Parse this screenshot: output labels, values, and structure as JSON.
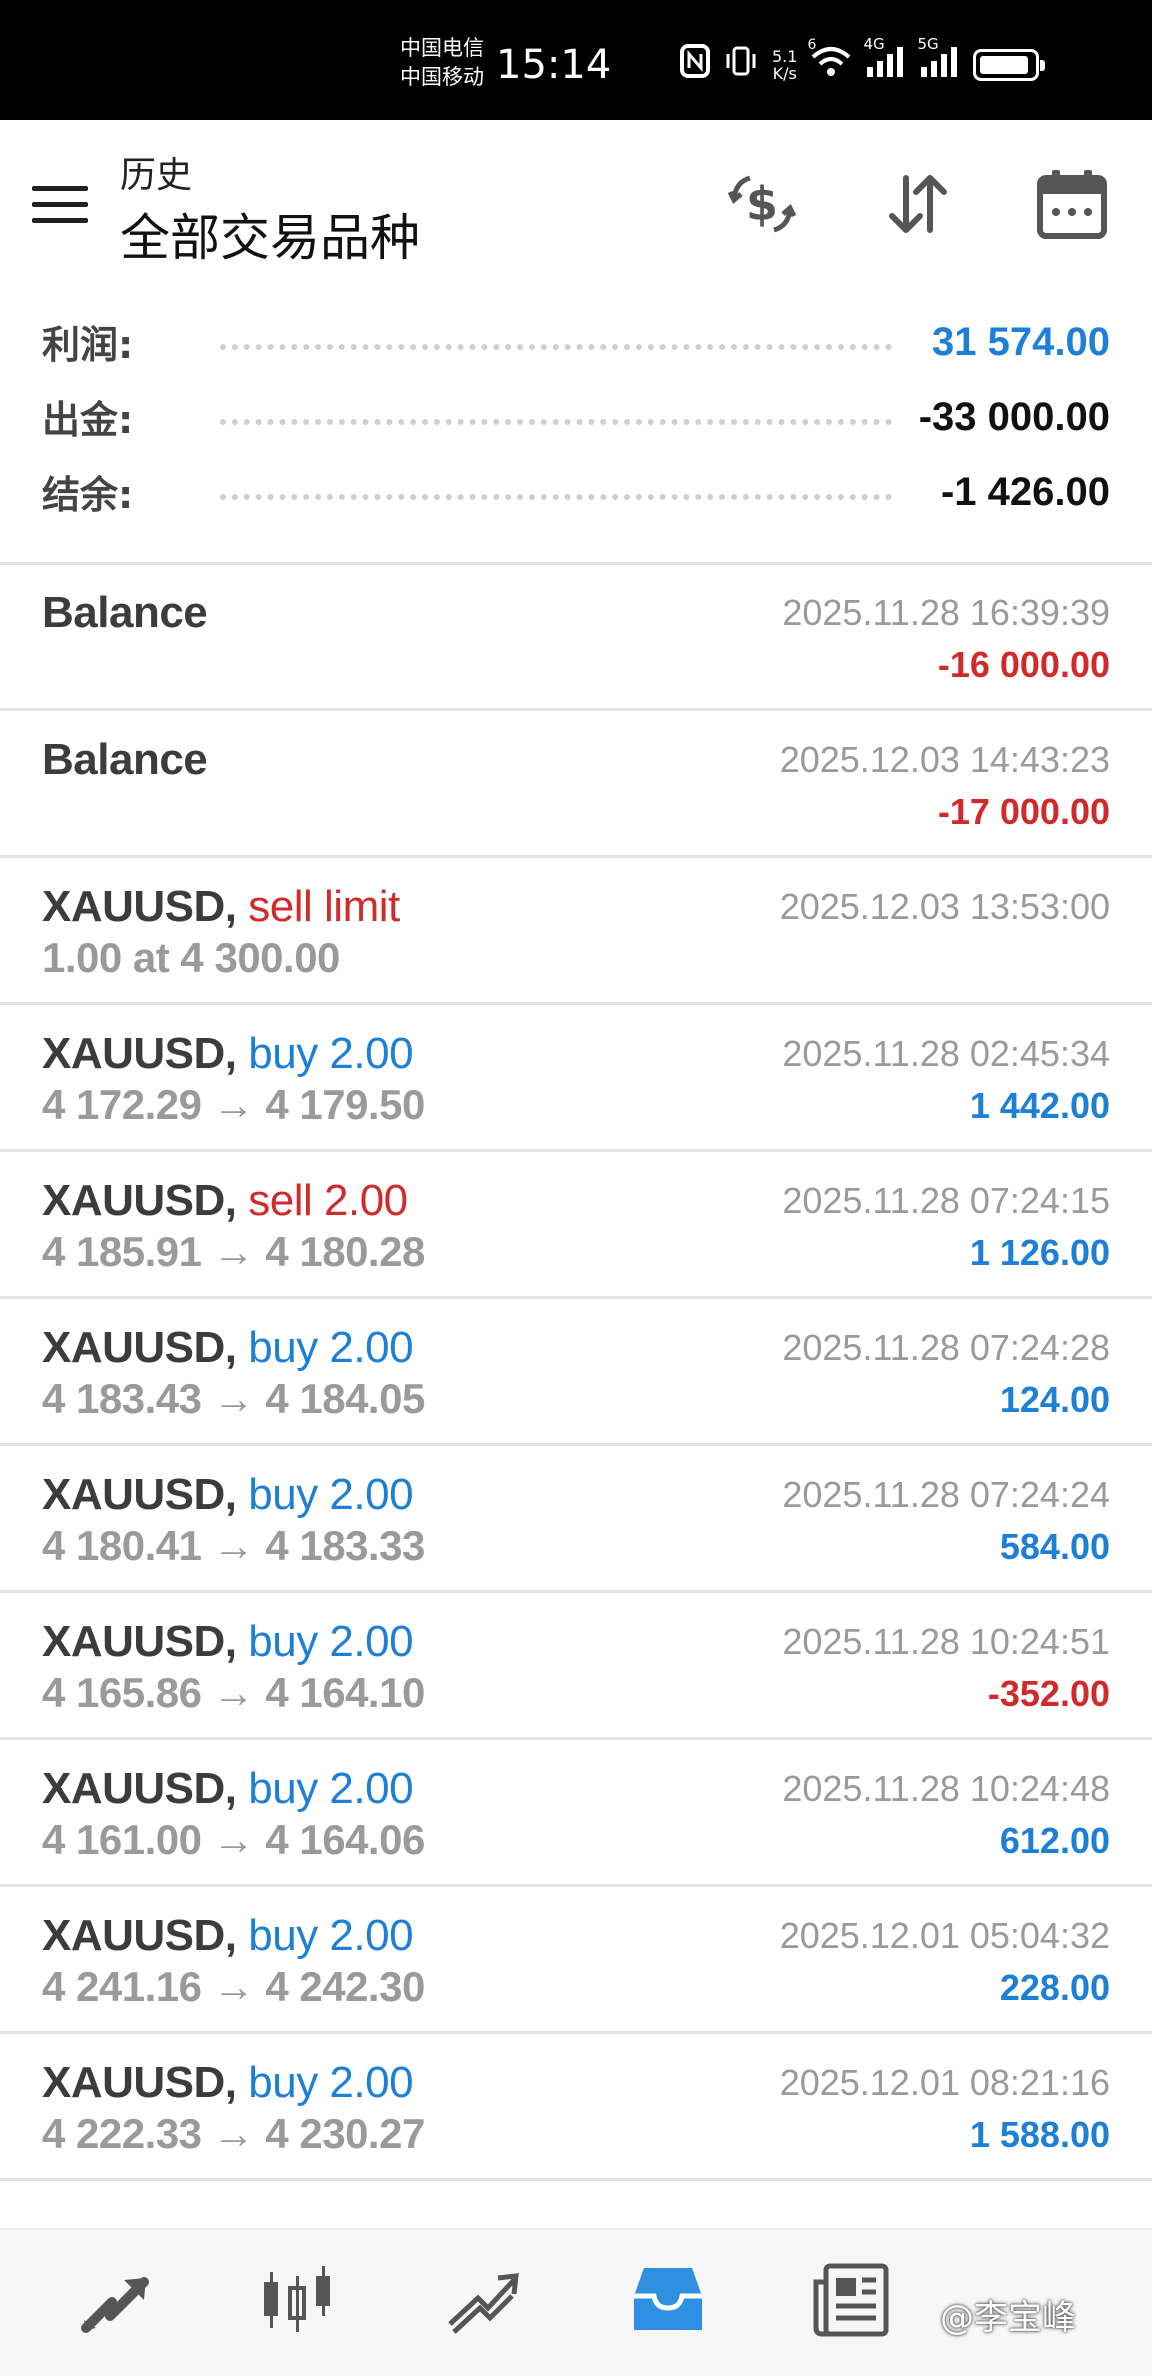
{
  "status_bar": {
    "carrier_1": "中国电信",
    "carrier_2": "中国移动",
    "time": "15:14",
    "net_speed_value": "5.1",
    "net_speed_unit": "K/s",
    "wifi_label": "6",
    "signal_1_label": "4G",
    "signal_2_label": "5G"
  },
  "header": {
    "title_small": "历史",
    "title_big": "全部交易品种",
    "icons": [
      "menu-icon",
      "currency-exchange-icon",
      "sort-icon",
      "calendar-icon"
    ]
  },
  "summary": {
    "profit_label": "利润:",
    "profit_value": "31 574.00",
    "withdrawal_label": "出金:",
    "withdrawal_value": "-33 000.00",
    "balance_label": "结余:",
    "balance_value": "-1 426.00"
  },
  "rows": [
    {
      "symbol": "Balance",
      "type": "",
      "type_class": "",
      "prices": "",
      "time": "2025.11.28 16:39:39",
      "profit": "-16 000.00",
      "profit_class": "neg"
    },
    {
      "symbol": "Balance",
      "type": "",
      "type_class": "",
      "prices": "",
      "time": "2025.12.03 14:43:23",
      "profit": "-17 000.00",
      "profit_class": "neg"
    },
    {
      "symbol": "XAUUSD,",
      "type": "sell limit",
      "type_class": "sell",
      "prices": "1.00 at 4 300.00",
      "time": "2025.12.03 13:53:00",
      "profit": "",
      "profit_class": "pos"
    },
    {
      "symbol": "XAUUSD,",
      "type": "buy 2.00",
      "type_class": "buy",
      "prices": "4 172.29 → 4 179.50",
      "time": "2025.11.28 02:45:34",
      "profit": "1 442.00",
      "profit_class": "pos"
    },
    {
      "symbol": "XAUUSD,",
      "type": "sell 2.00",
      "type_class": "sell",
      "prices": "4 185.91 → 4 180.28",
      "time": "2025.11.28 07:24:15",
      "profit": "1 126.00",
      "profit_class": "pos"
    },
    {
      "symbol": "XAUUSD,",
      "type": "buy 2.00",
      "type_class": "buy",
      "prices": "4 183.43 → 4 184.05",
      "time": "2025.11.28 07:24:28",
      "profit": "124.00",
      "profit_class": "pos"
    },
    {
      "symbol": "XAUUSD,",
      "type": "buy 2.00",
      "type_class": "buy",
      "prices": "4 180.41 → 4 183.33",
      "time": "2025.11.28 07:24:24",
      "profit": "584.00",
      "profit_class": "pos"
    },
    {
      "symbol": "XAUUSD,",
      "type": "buy 2.00",
      "type_class": "buy",
      "prices": "4 165.86 → 4 164.10",
      "time": "2025.11.28 10:24:51",
      "profit": "-352.00",
      "profit_class": "neg"
    },
    {
      "symbol": "XAUUSD,",
      "type": "buy 2.00",
      "type_class": "buy",
      "prices": "4 161.00 → 4 164.06",
      "time": "2025.11.28 10:24:48",
      "profit": "612.00",
      "profit_class": "pos"
    },
    {
      "symbol": "XAUUSD,",
      "type": "buy 2.00",
      "type_class": "buy",
      "prices": "4 241.16 → 4 242.30",
      "time": "2025.12.01 05:04:32",
      "profit": "228.00",
      "profit_class": "pos"
    },
    {
      "symbol": "XAUUSD,",
      "type": "buy 2.00",
      "type_class": "buy",
      "prices": "4 222.33 → 4 230.27",
      "time": "2025.12.01 08:21:16",
      "profit": "1 588.00",
      "profit_class": "pos"
    }
  ],
  "colors": {
    "blue": "#1e7fd6",
    "red": "#d12a2a",
    "active_tab": "#2f8fe0",
    "icon_gray": "#555555"
  },
  "bottom_nav": {
    "items": [
      "quotes-icon",
      "chart-icon",
      "trade-icon",
      "history-icon",
      "news-icon"
    ],
    "active": "history-icon"
  },
  "watermark": "@李宝峰"
}
